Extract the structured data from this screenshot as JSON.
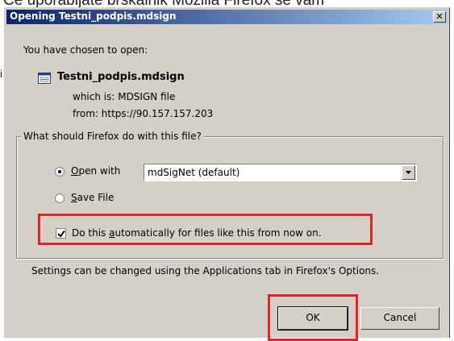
{
  "background": {
    "text": "Če uporabljate brskalnik Mozilla Firefox se vam",
    "fragment": "i"
  },
  "dialog": {
    "title": "Opening Testni_podpis.mdsign",
    "close_glyph": "✕",
    "chosen_label": "You have chosen to open:",
    "file_icon": "document-icon",
    "filename": "Testni_podpis.mdsign",
    "which_is": "which is:  MDSIGN file",
    "from": "from:  https://90.157.157.203",
    "group_legend": "What should Firefox do with this file?",
    "open_with": {
      "prefix": "",
      "accel": "O",
      "rest": "pen with",
      "selected": true
    },
    "app_select": {
      "value": "mdSigNet (default)"
    },
    "save_file": {
      "accel": "S",
      "rest": "ave File",
      "selected": false
    },
    "auto_checkbox": {
      "before": "Do this ",
      "accel": "a",
      "after": "utomatically for files like this from now on.",
      "checked": true
    },
    "settings_note": "Settings can be changed using the Applications tab in Firefox's Options.",
    "ok_label": "OK",
    "cancel_label": "Cancel"
  },
  "colors": {
    "titlebar_start": "#0a246a",
    "titlebar_end": "#a6caf0",
    "highlight": "#e3232a",
    "dialog_bg": "#d4d0c8"
  }
}
